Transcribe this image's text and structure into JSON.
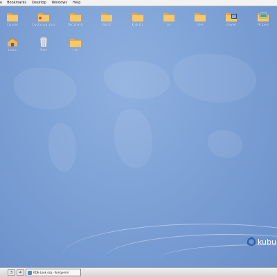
{
  "menubar": {
    "items": [
      "e",
      "Bookmarks",
      "Desktop",
      "Windows",
      "Help"
    ]
  },
  "desktop_icons": [
    {
      "label": "Courses",
      "icon": "folder-icon"
    },
    {
      "label": "Crystal.svg icons",
      "icon": "folder-icon"
    },
    {
      "label": "Documents",
      "icon": "folder-icon"
    },
    {
      "label": "Words",
      "icon": "folder-icon"
    },
    {
      "label": "Kubuntu",
      "icon": "folder-icon"
    },
    {
      "label": "Lin",
      "icon": "folder-icon"
    },
    {
      "label": "Sites",
      "icon": "folder-icon"
    },
    {
      "label": "movies",
      "icon": "movies-folder-icon"
    },
    {
      "label": "Pictures",
      "icon": "pictures-folder-icon"
    },
    {
      "label": "Home",
      "icon": "home-icon"
    },
    {
      "label": "Trash",
      "icon": "trash-icon"
    },
    {
      "label": "Lab",
      "icon": "folder-icon"
    }
  ],
  "logo": {
    "text": "kubu"
  },
  "taskbar": {
    "pager": [
      "3",
      "4"
    ],
    "task_label": "KDE-Look.org - Konqueror"
  },
  "colors": {
    "desktop": "#7ea2d6",
    "folder": "#f6c15a",
    "taskbar": "#e2e2e2"
  }
}
